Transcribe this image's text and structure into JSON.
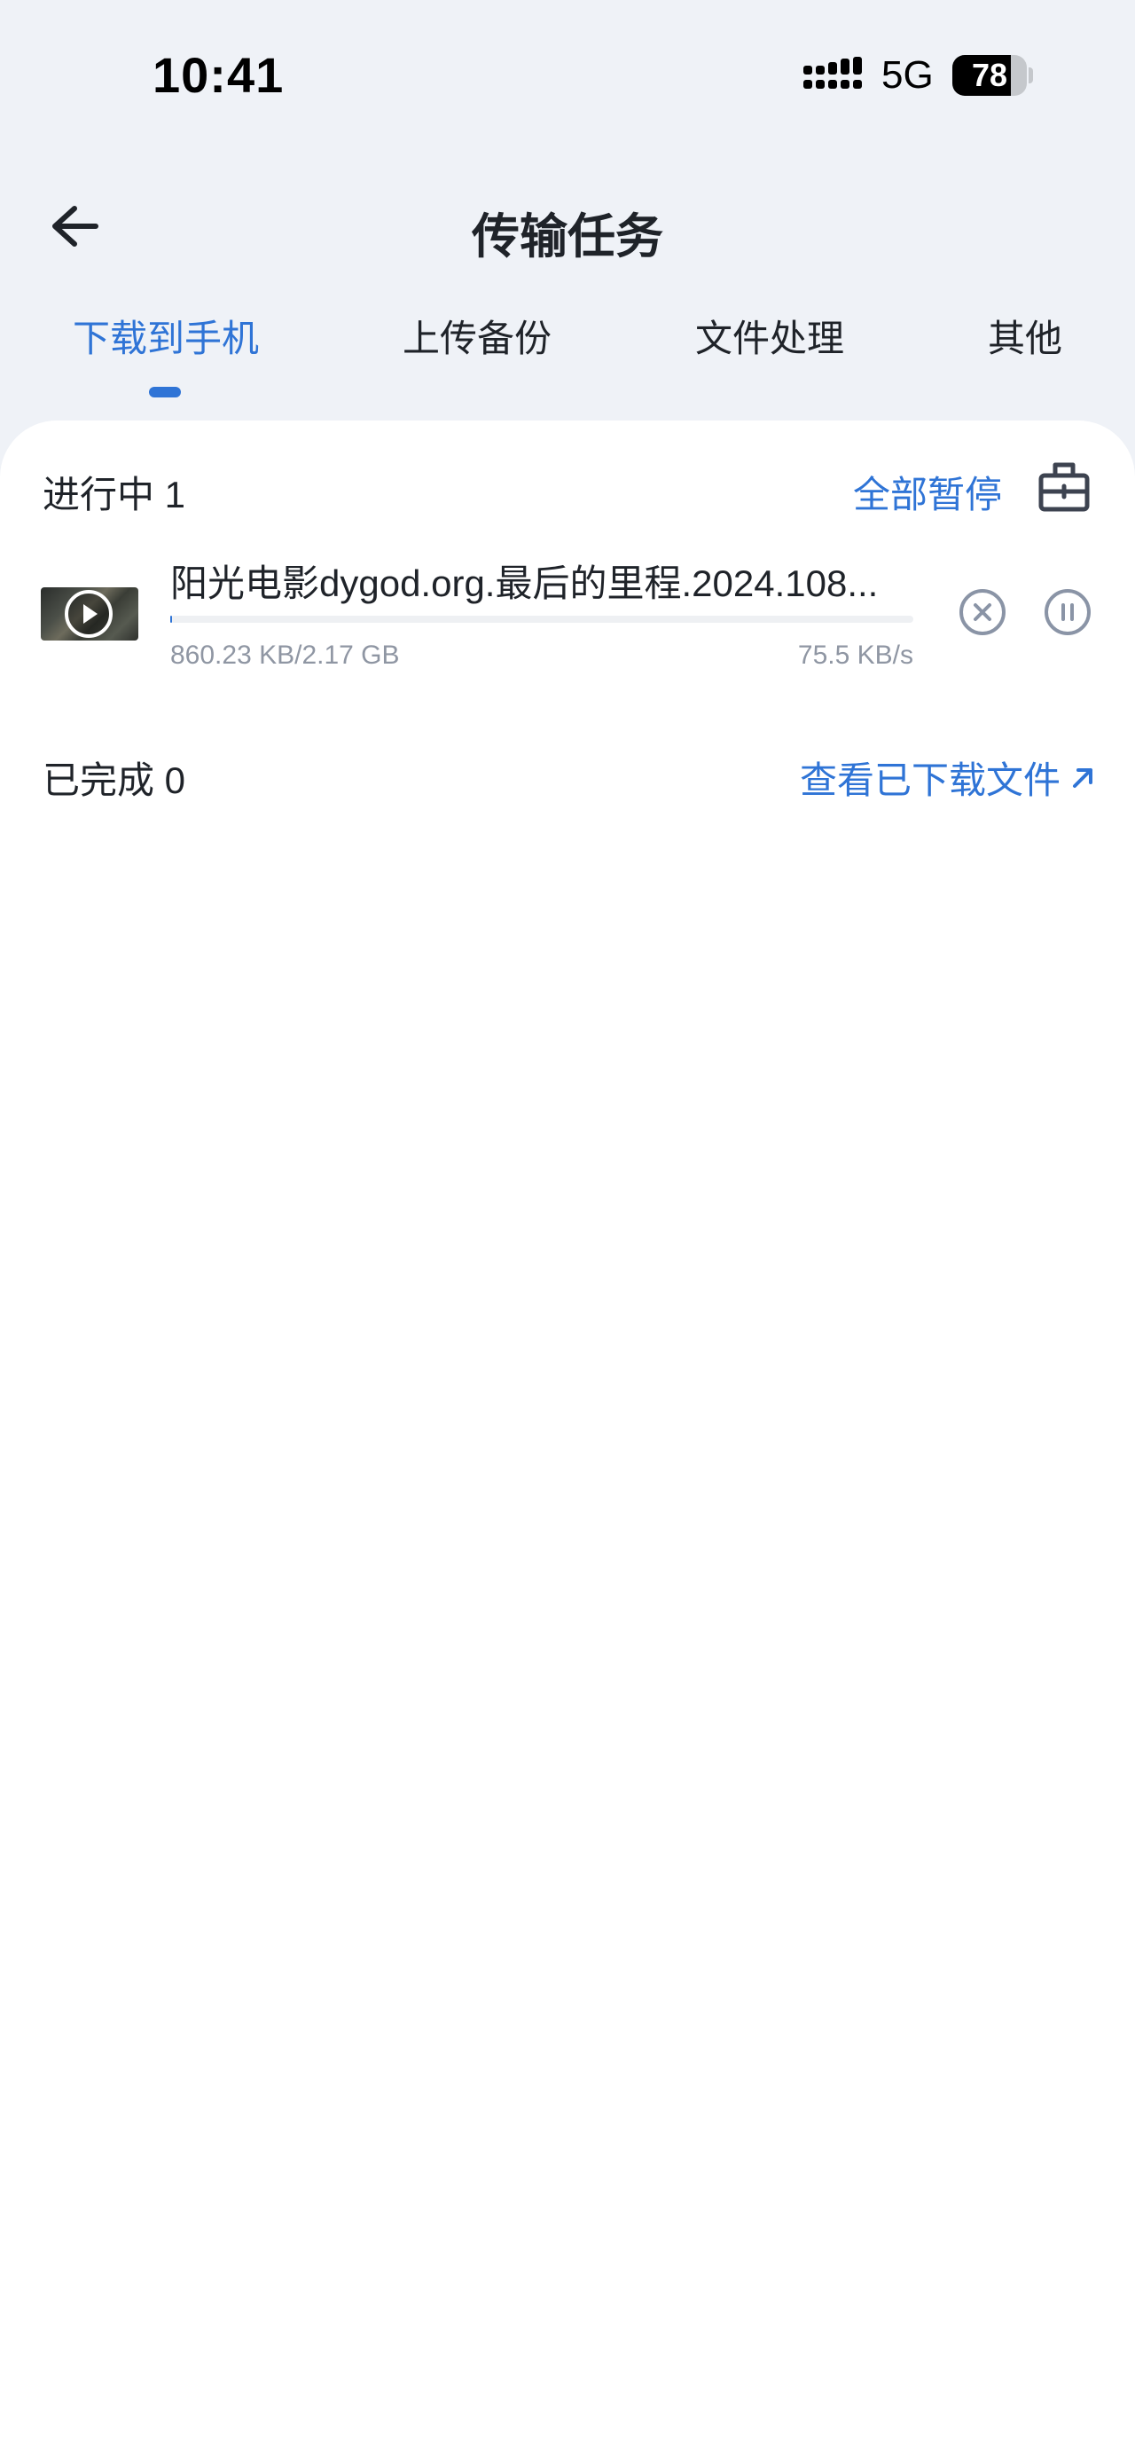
{
  "status_bar": {
    "time": "10:41",
    "network": "5G",
    "battery_level": "78",
    "battery_fraction": 0.78
  },
  "nav": {
    "title": "传输任务",
    "back_icon": "arrow-left-icon"
  },
  "tabs": [
    {
      "label": "下载到手机",
      "active": true
    },
    {
      "label": "上传备份",
      "active": false
    },
    {
      "label": "文件处理",
      "active": false
    },
    {
      "label": "其他",
      "active": false
    }
  ],
  "in_progress": {
    "title": "进行中 1",
    "pause_all_label": "全部暂停",
    "clean_icon": "clear-toolbox-icon",
    "task": {
      "thumbnail_icon": "play-icon",
      "file_name": "阳光电影dygod.org.最后的里程.2024.108...",
      "size_text": "860.23 KB/2.17 GB",
      "speed_text": "75.5 KB/s",
      "progress_fraction": 0.0004,
      "cancel_icon": "cancel-icon",
      "pause_icon": "pause-icon"
    }
  },
  "completed": {
    "title": "已完成 0",
    "view_files_label": "查看已下载文件",
    "view_files_icon": "arrow-up-right-icon"
  },
  "colors": {
    "accent": "#2f74d6",
    "background": "#eff2f7",
    "card": "#ffffff",
    "muted_text": "#8f96a3"
  }
}
